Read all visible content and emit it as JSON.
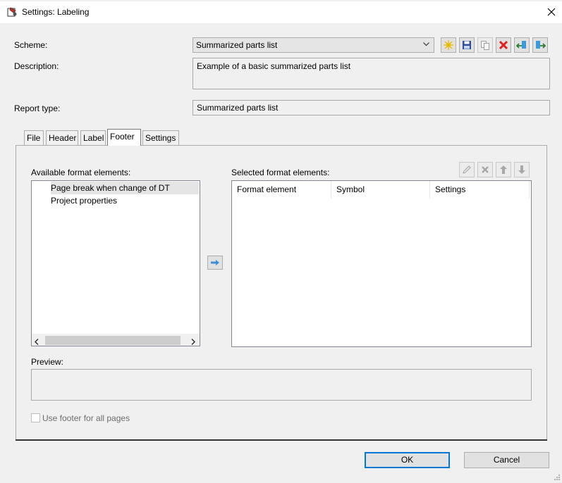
{
  "window": {
    "title": "Settings: Labeling"
  },
  "form": {
    "scheme_label": "Scheme:",
    "scheme_value": "Summarized parts list",
    "description_label": "Description:",
    "description_value": "Example of a basic summarized parts list",
    "report_type_label": "Report type:",
    "report_type_value": "Summarized parts list"
  },
  "scheme_toolbar": [
    "new-icon",
    "save-icon",
    "copy-icon",
    "delete-icon",
    "import-icon",
    "export-icon"
  ],
  "tabs": [
    {
      "label": "File"
    },
    {
      "label": "Header"
    },
    {
      "label": "Label"
    },
    {
      "label": "Footer",
      "active": true
    },
    {
      "label": "Settings"
    }
  ],
  "footer": {
    "available_label": "Available format elements:",
    "available_items": [
      "Page break when change of DT",
      "Project properties"
    ],
    "selected_label": "Selected format elements:",
    "columns": [
      "Format element",
      "Symbol",
      "Settings"
    ],
    "preview_label": "Preview:",
    "use_footer_label": "Use footer for all pages"
  },
  "buttons": {
    "ok": "OK",
    "cancel": "Cancel"
  },
  "colors": {
    "accent": "#0078d7",
    "selection": "#e5e5e5",
    "background": "#f0f0f0"
  }
}
